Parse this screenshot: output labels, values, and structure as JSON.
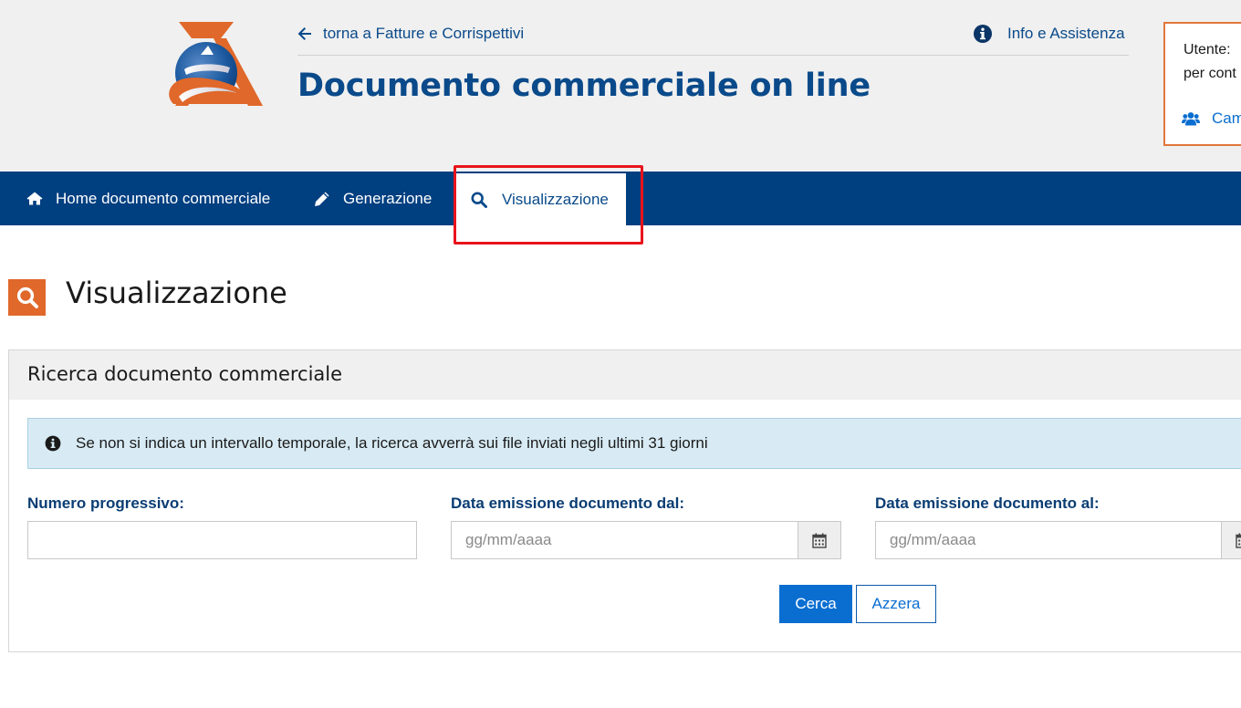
{
  "header": {
    "back_link": "torna a Fatture e Corrispettivi",
    "info_link": "Info e Assistenza",
    "app_title": "Documento commerciale on line",
    "user_box": {
      "line1": "Utente: ",
      "line2": "per cont",
      "change_link": "Cam"
    }
  },
  "nav": {
    "items": [
      {
        "label": "Home documento commerciale",
        "icon": "home-icon"
      },
      {
        "label": "Generazione",
        "icon": "pencil-icon"
      },
      {
        "label": "Visualizzazione",
        "icon": "search-icon",
        "active": true
      }
    ]
  },
  "page": {
    "title": "Visualizzazione"
  },
  "search_panel": {
    "title": "Ricerca documento commerciale",
    "info_message": "Se non si indica un intervallo temporale, la ricerca avverrà sui file inviati negli ultimi 31 giorni",
    "fields": {
      "numero": {
        "label": "Numero progressivo:",
        "value": "",
        "placeholder": ""
      },
      "data_dal": {
        "label": "Data emissione documento dal:",
        "value": "",
        "placeholder": "gg/mm/aaaa"
      },
      "data_al": {
        "label": "Data emissione documento al:",
        "value": "",
        "placeholder": "gg/mm/aaaa"
      }
    },
    "buttons": {
      "search": "Cerca",
      "reset": "Azzera"
    }
  },
  "colors": {
    "brand_blue": "#003f80",
    "title_blue": "#0a4a8a",
    "accent_orange": "#e0682a",
    "highlight_red": "#e8141c",
    "primary_button": "#0a6ed1",
    "info_bg": "#d8ebf4"
  }
}
